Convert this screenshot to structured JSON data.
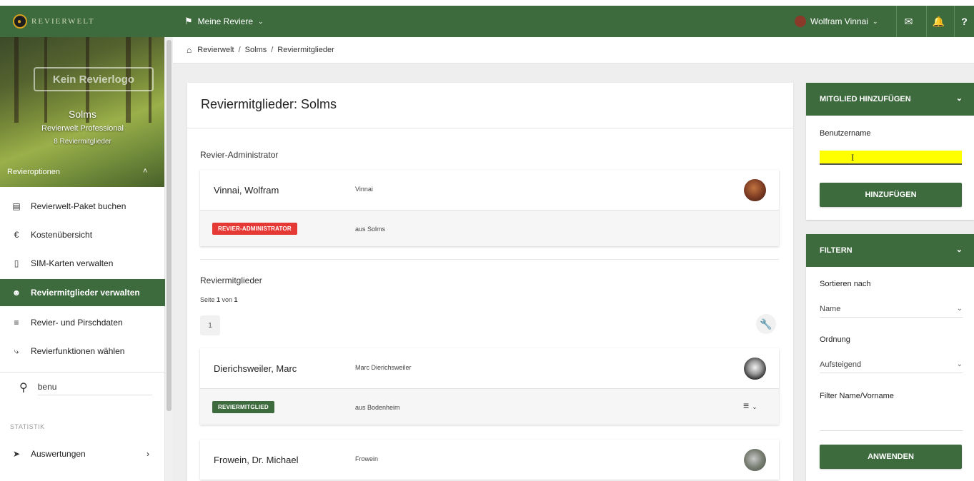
{
  "brand": {
    "name": "REVIERWELT"
  },
  "topnav": {
    "reviere_label": "Meine Reviere",
    "user_name": "Wolfram Vinnai"
  },
  "breadcrumb": [
    "Revierwelt",
    "Solms",
    "Reviermitglieder"
  ],
  "sidebar": {
    "placeholder_text": "Kein Revierlogo",
    "revier_name": "Solms",
    "revier_plan": "Revierwelt Professional",
    "member_count": "8 Reviermitglieder",
    "options_label": "Revieroptionen",
    "items": [
      {
        "label": "Revierwelt-Paket buchen",
        "icon": "credit-card-icon"
      },
      {
        "label": "Kostenübersicht",
        "icon": "euro-icon"
      },
      {
        "label": "SIM-Karten verwalten",
        "icon": "sim-card-icon"
      },
      {
        "label": "Reviermitglieder verwalten",
        "icon": "users-icon",
        "active": true
      },
      {
        "label": "Revier- und Pirschdaten",
        "icon": "database-icon"
      },
      {
        "label": "Revierfunktionen wählen",
        "icon": "wrench-icon"
      }
    ],
    "search_value": "benu",
    "section_statistik": "STATISTIK",
    "auswertungen": "Auswertungen"
  },
  "main": {
    "title": "Reviermitglieder: Solms",
    "admin_section": "Revier-Administrator",
    "admin": {
      "name": "Vinnai, Wolfram",
      "username": "Vinnai",
      "role": "REVIER-ADMINISTRATOR",
      "from": "aus Solms"
    },
    "members_section": "Reviermitglieder",
    "page_prefix": "Seite ",
    "page_current": "1",
    "page_mid": " von ",
    "page_total": "1",
    "page_button": "1",
    "members": [
      {
        "name": "Dierichsweiler, Marc",
        "username": "Marc Dierichsweiler",
        "role": "REVIERMITGLIED",
        "from": "aus Bodenheim"
      },
      {
        "name": "Frowein, Dr. Michael",
        "username": "Frowein"
      }
    ]
  },
  "add_panel": {
    "title": "MITGLIED HINZUFÜGEN",
    "username_label": "Benutzername",
    "username_value": "",
    "button": "HINZUFÜGEN"
  },
  "filter_panel": {
    "title": "FILTERN",
    "sort_label": "Sortieren nach",
    "sort_value": "Name",
    "order_label": "Ordnung",
    "order_value": "Aufsteigend",
    "name_filter_label": "Filter Name/Vorname",
    "button": "ANWENDEN"
  },
  "colors": {
    "primary": "#3d6b3e",
    "admin_badge": "#e53935",
    "highlight": "#ffff00"
  }
}
